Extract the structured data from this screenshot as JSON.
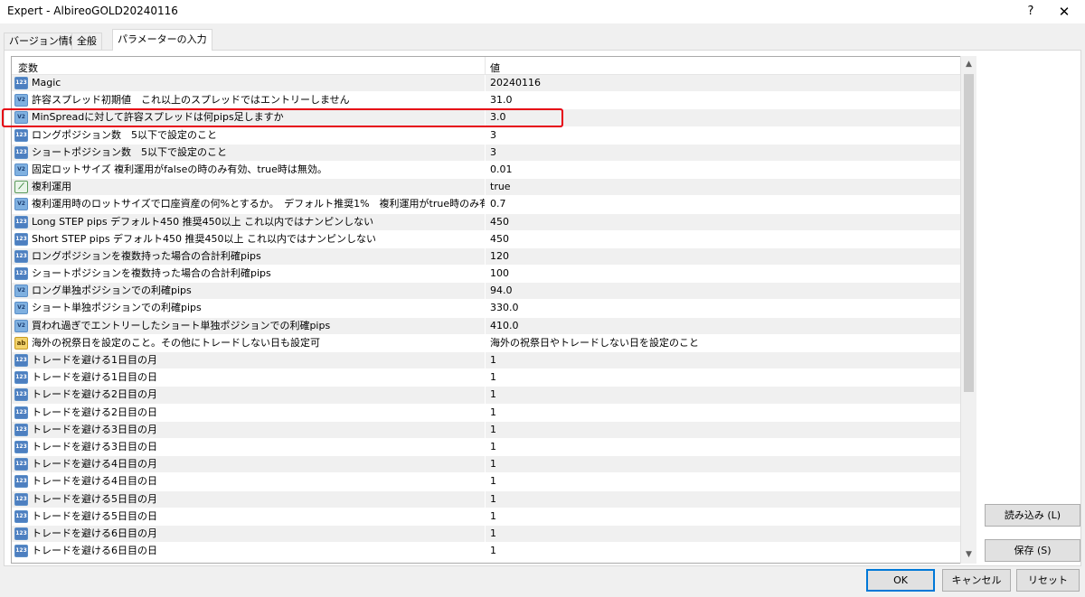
{
  "window": {
    "title": "Expert - AlbireoGOLD20240116",
    "help_glyph": "?",
    "close_glyph": "✕"
  },
  "tabs": [
    {
      "label": "バージョン情報",
      "active": false
    },
    {
      "label": "全般",
      "active": false
    },
    {
      "label": "パラメーターの入力",
      "active": true
    }
  ],
  "grid": {
    "col_name": "変数",
    "col_value": "値",
    "rows": [
      {
        "type": "int",
        "name": "Magic",
        "value": "20240116"
      },
      {
        "type": "dbl",
        "name": "許容スプレッド初期値　これ以上のスプレッドではエントリーしません",
        "value": "31.0"
      },
      {
        "type": "dbl",
        "name": "MinSpreadに対して許容スプレッドは何pips足しますか",
        "value": "3.0"
      },
      {
        "type": "int",
        "name": "ロングポジション数　5以下で設定のこと",
        "value": "3"
      },
      {
        "type": "int",
        "name": "ショートポジション数　5以下で設定のこと",
        "value": "3"
      },
      {
        "type": "dbl",
        "name": "固定ロットサイズ 複利運用がfalseの時のみ有効、true時は無効。",
        "value": "0.01"
      },
      {
        "type": "bool",
        "name": "複利運用",
        "value": "true"
      },
      {
        "type": "dbl",
        "name": "複利運用時のロットサイズで口座資産の何%とするか。　デフォルト推奨1%　複利運用がtrue時のみ有効",
        "value": "0.7"
      },
      {
        "type": "int",
        "name": "Long STEP pips デフォルト450 推奨450以上 これ以内ではナンピンしない",
        "value": "450"
      },
      {
        "type": "int",
        "name": "Short STEP pips デフォルト450 推奨450以上 これ以内ではナンピンしない",
        "value": "450"
      },
      {
        "type": "int",
        "name": "ロングポジションを複数持った場合の合計利確pips",
        "value": "120"
      },
      {
        "type": "int",
        "name": "ショートポジションを複数持った場合の合計利確pips",
        "value": "100"
      },
      {
        "type": "dbl",
        "name": "ロング単独ポジションでの利確pips",
        "value": "94.0"
      },
      {
        "type": "dbl",
        "name": "ショート単独ポジションでの利確pips",
        "value": "330.0"
      },
      {
        "type": "dbl",
        "name": "買われ過ぎでエントリーしたショート単独ポジションでの利確pips",
        "value": "410.0"
      },
      {
        "type": "str",
        "name": "海外の祝祭日を設定のこと。その他にトレードしない日も設定可",
        "value": "海外の祝祭日やトレードしない日を設定のこと"
      },
      {
        "type": "int",
        "name": "トレードを避ける1日目の月",
        "value": "1"
      },
      {
        "type": "int",
        "name": "トレードを避ける1日目の日",
        "value": "1"
      },
      {
        "type": "int",
        "name": "トレードを避ける2日目の月",
        "value": "1"
      },
      {
        "type": "int",
        "name": "トレードを避ける2日目の日",
        "value": "1"
      },
      {
        "type": "int",
        "name": "トレードを避ける3日目の月",
        "value": "1"
      },
      {
        "type": "int",
        "name": "トレードを避ける3日目の日",
        "value": "1"
      },
      {
        "type": "int",
        "name": "トレードを避ける4日目の月",
        "value": "1"
      },
      {
        "type": "int",
        "name": "トレードを避ける4日目の日",
        "value": "1"
      },
      {
        "type": "int",
        "name": "トレードを避ける5日目の月",
        "value": "1"
      },
      {
        "type": "int",
        "name": "トレードを避ける5日目の日",
        "value": "1"
      },
      {
        "type": "int",
        "name": "トレードを避ける6日目の月",
        "value": "1"
      },
      {
        "type": "int",
        "name": "トレードを避ける6日目の日",
        "value": "1"
      }
    ]
  },
  "icon_glyphs": {
    "int": "123",
    "dbl": "V2",
    "bool": "⟋",
    "str": "ab"
  },
  "buttons": {
    "load": "読み込み (L)",
    "save": "保存 (S)",
    "ok": "OK",
    "cancel": "キャンセル",
    "reset": "リセット"
  },
  "colors": {
    "highlight": "#e60012",
    "ok_border": "#0078d7"
  }
}
